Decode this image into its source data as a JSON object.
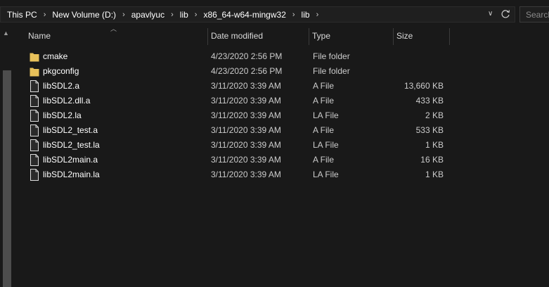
{
  "address": {
    "crumbs": [
      "This PC",
      "New Volume (D:)",
      "apavlyuc",
      "lib",
      "x86_64-w64-mingw32",
      "lib"
    ],
    "separator": "›",
    "dropdown_glyph": "∨",
    "refresh_icon": "refresh-icon"
  },
  "search": {
    "placeholder": "Search"
  },
  "columns": {
    "name": "Name",
    "date": "Date modified",
    "type": "Type",
    "size": "Size"
  },
  "files": [
    {
      "name": "cmake",
      "date": "4/23/2020 2:56 PM",
      "type": "File folder",
      "size": "",
      "icon": "folder-icon"
    },
    {
      "name": "pkgconfig",
      "date": "4/23/2020 2:56 PM",
      "type": "File folder",
      "size": "",
      "icon": "folder-icon"
    },
    {
      "name": "libSDL2.a",
      "date": "3/11/2020 3:39 AM",
      "type": "A File",
      "size": "13,660 KB",
      "icon": "file-icon"
    },
    {
      "name": "libSDL2.dll.a",
      "date": "3/11/2020 3:39 AM",
      "type": "A File",
      "size": "433 KB",
      "icon": "file-icon"
    },
    {
      "name": "libSDL2.la",
      "date": "3/11/2020 3:39 AM",
      "type": "LA File",
      "size": "2 KB",
      "icon": "file-icon"
    },
    {
      "name": "libSDL2_test.a",
      "date": "3/11/2020 3:39 AM",
      "type": "A File",
      "size": "533 KB",
      "icon": "file-icon"
    },
    {
      "name": "libSDL2_test.la",
      "date": "3/11/2020 3:39 AM",
      "type": "LA File",
      "size": "1 KB",
      "icon": "file-icon"
    },
    {
      "name": "libSDL2main.a",
      "date": "3/11/2020 3:39 AM",
      "type": "A File",
      "size": "16 KB",
      "icon": "file-icon"
    },
    {
      "name": "libSDL2main.la",
      "date": "3/11/2020 3:39 AM",
      "type": "LA File",
      "size": "1 KB",
      "icon": "file-icon"
    }
  ],
  "colors": {
    "folder": "#e8c15a",
    "file_outline": "#dcdcdc",
    "background": "#191919"
  }
}
